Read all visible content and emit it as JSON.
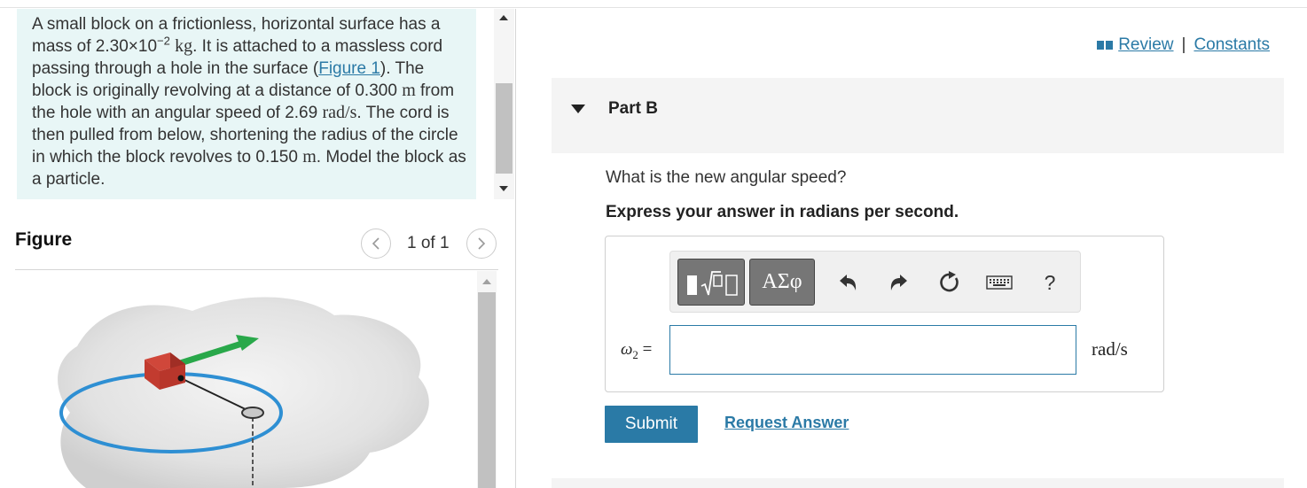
{
  "problem": {
    "text_1": "A small block on a frictionless, horizontal surface has a mass of 2.30×10",
    "mass_exp": "−2",
    "mass_unit": "kg",
    "text_2": ". It is attached to a massless cord passing through a hole in the surface (",
    "figure_link": "Figure 1",
    "text_3": "). The block is originally revolving at a distance of 0.300 ",
    "unit_m": "m",
    "text_4": " from the hole with an angular speed of 2.69 ",
    "unit_rads": "rad/s",
    "text_5": ". The cord is then pulled from below, shortening the radius of the circle in which the block revolves to 0.150 ",
    "unit_m2": "m",
    "text_6": ". Model the block as a particle."
  },
  "figure": {
    "title": "Figure",
    "counter": "1 of 1",
    "prev_icon": "chevron-left-icon",
    "next_icon": "chevron-right-icon"
  },
  "header_links": {
    "review": "Review",
    "separator": "|",
    "constants": "Constants"
  },
  "part": {
    "title": "Part B",
    "question": "What is the new angular speed?",
    "instruction": "Express your answer in radians per second."
  },
  "toolbar": {
    "templates_icon": "templates-icon",
    "symbols_label": "ΑΣφ",
    "undo_icon": "undo-icon",
    "redo_icon": "redo-icon",
    "reset_icon": "reset-icon",
    "keyboard_icon": "keyboard-icon",
    "help_label": "?"
  },
  "answer": {
    "variable": "ω",
    "subscript": "2",
    "equals": " =",
    "value": "",
    "unit": "rad/s"
  },
  "actions": {
    "submit": "Submit",
    "request": "Request Answer"
  },
  "colors": {
    "accent": "#2a7aa6",
    "problem_bg": "#e8f6f6",
    "header_bg": "#f4f4f4"
  }
}
